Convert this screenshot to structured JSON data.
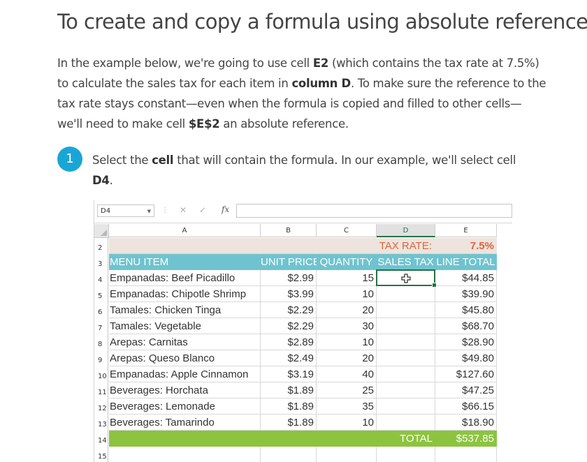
{
  "heading": "To create and copy a formula using absolute references:",
  "intro": {
    "t1": "In the example below, we're going to use cell ",
    "b1": "E2",
    "t2": " (which contains the tax rate at 7.5%) to calculate the sales tax for each item in ",
    "b2": "column D",
    "t3": ". To make sure the reference to the tax rate stays constant—even when the formula is copied and filled to other cells—we'll need to make cell ",
    "b3": "$E$2",
    "t4": " an absolute reference."
  },
  "step": {
    "number": "1",
    "t1": "Select the ",
    "b1": "cell",
    "t2": " that will contain the formula. In our example, we'll select cell ",
    "b2": "D4",
    "t3": "."
  },
  "excel": {
    "name_box": "D4",
    "cancel_glyph": "✕",
    "enter_glyph": "✓",
    "fx_label": "fx",
    "formula_value": "",
    "columns": [
      "A",
      "B",
      "C",
      "D",
      "E"
    ],
    "selected_column": "D",
    "row_numbers": [
      "2",
      "3",
      "4",
      "5",
      "6",
      "7",
      "8",
      "9",
      "10",
      "11",
      "12",
      "13",
      "14",
      "15"
    ],
    "tax_rate_label": "TAX RATE:",
    "tax_rate_value": "7.5%",
    "headers": [
      "MENU ITEM",
      "UNIT PRICE",
      "QUANTITY",
      "SALES TAX",
      "LINE TOTAL"
    ],
    "rows": [
      [
        "Empanadas: Beef Picadillo",
        "$2.99",
        "15",
        "",
        "$44.85"
      ],
      [
        "Empanadas: Chipotle Shrimp",
        "$3.99",
        "10",
        "",
        "$39.90"
      ],
      [
        "Tamales: Chicken Tinga",
        "$2.29",
        "20",
        "",
        "$45.80"
      ],
      [
        "Tamales: Vegetable",
        "$2.29",
        "30",
        "",
        "$68.70"
      ],
      [
        "Arepas: Carnitas",
        "$2.89",
        "10",
        "",
        "$28.90"
      ],
      [
        "Arepas: Queso Blanco",
        "$2.49",
        "20",
        "",
        "$49.80"
      ],
      [
        "Empanadas: Apple Cinnamon",
        "$3.19",
        "40",
        "",
        "$127.60"
      ],
      [
        "Beverages: Horchata",
        "$1.89",
        "25",
        "",
        "$47.25"
      ],
      [
        "Beverages: Lemonade",
        "$1.89",
        "35",
        "",
        "$66.15"
      ],
      [
        "Beverages: Tamarindo",
        "$1.89",
        "10",
        "",
        "$18.90"
      ]
    ],
    "total_label": "TOTAL",
    "total_value": "$537.85",
    "selected_cell": "D4",
    "colors": {
      "header_bg": "#6fc3cf",
      "total_bg": "#8cc43f",
      "tax_text": "#e0643c",
      "tax_row_bg": "#ece4dd",
      "selection": "#217346",
      "step_badge": "#19a6d6"
    }
  }
}
